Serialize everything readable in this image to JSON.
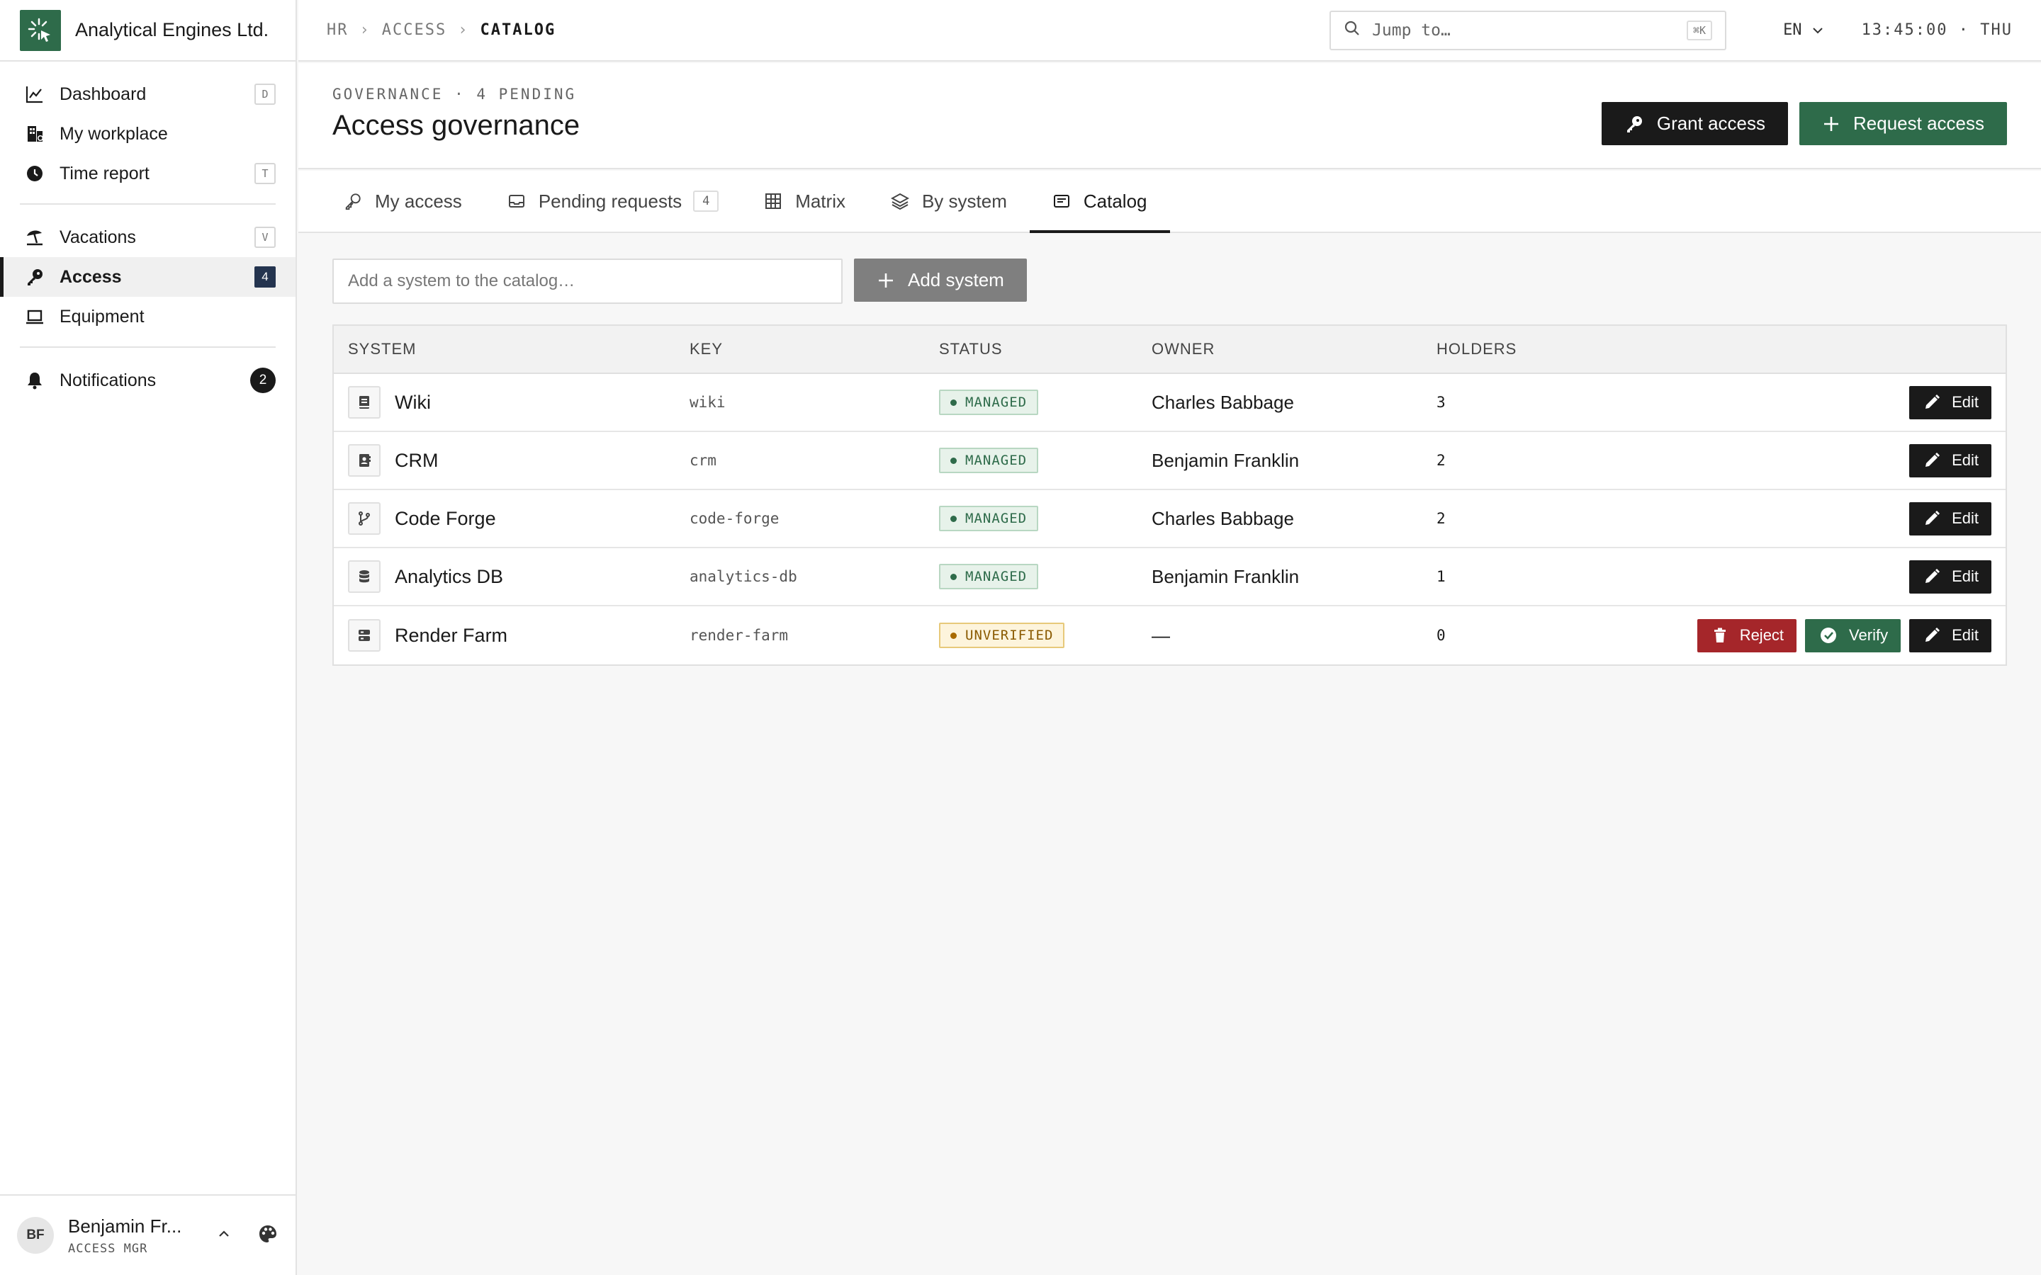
{
  "brand": {
    "name": "Analytical Engines Ltd.",
    "logo_icon": "spark-cursor-icon",
    "accent": "#2e6b4a"
  },
  "sidebar": {
    "groups": [
      [
        {
          "id": "dashboard",
          "label": "Dashboard",
          "icon": "chart-line-icon",
          "shortcut": "D"
        },
        {
          "id": "my-workplace",
          "label": "My workplace",
          "icon": "building-icon",
          "shortcut": ""
        },
        {
          "id": "time-report",
          "label": "Time report",
          "icon": "clock-icon",
          "shortcut": "T"
        }
      ],
      [
        {
          "id": "vacations",
          "label": "Vacations",
          "icon": "umbrella-beach-icon",
          "shortcut": "V"
        },
        {
          "id": "access",
          "label": "Access",
          "icon": "key-icon",
          "count": "4",
          "active": true
        },
        {
          "id": "equipment",
          "label": "Equipment",
          "icon": "laptop-icon",
          "shortcut": ""
        }
      ],
      [
        {
          "id": "notifications",
          "label": "Notifications",
          "icon": "bell-icon",
          "count": "2"
        }
      ]
    ]
  },
  "user": {
    "initials": "BF",
    "name": "Benjamin Fr...",
    "role": "ACCESS MGR"
  },
  "topbar": {
    "breadcrumb": [
      "HR",
      "ACCESS",
      "CATALOG"
    ],
    "search_placeholder": "Jump to…",
    "search_shortcut": "⌘K",
    "language": "EN",
    "clock": "13:45:00 · THU"
  },
  "header": {
    "eyebrow": "GOVERNANCE · 4 PENDING",
    "title": "Access governance",
    "grant_label": "Grant access",
    "request_label": "Request access"
  },
  "tabs": [
    {
      "label": "My access",
      "icon": "key-icon"
    },
    {
      "label": "Pending requests",
      "icon": "inbox-icon",
      "badge": "4"
    },
    {
      "label": "Matrix",
      "icon": "grid-icon"
    },
    {
      "label": "By system",
      "icon": "layers-icon"
    },
    {
      "label": "Catalog",
      "icon": "catalog-icon",
      "active": true
    }
  ],
  "catalog": {
    "add_placeholder": "Add a system to the catalog…",
    "add_button": "Add system",
    "columns": {
      "system": "SYSTEM",
      "key": "KEY",
      "status": "STATUS",
      "owner": "OWNER",
      "holders": "HOLDERS"
    },
    "rows": [
      {
        "name": "Wiki",
        "icon": "book-icon",
        "key": "wiki",
        "status": "MANAGED",
        "status_kind": "managed",
        "owner": "Charles Babbage",
        "holders": "3",
        "actions": [
          "edit"
        ]
      },
      {
        "name": "CRM",
        "icon": "contact-card-icon",
        "key": "crm",
        "status": "MANAGED",
        "status_kind": "managed",
        "owner": "Benjamin Franklin",
        "holders": "2",
        "actions": [
          "edit"
        ]
      },
      {
        "name": "Code Forge",
        "icon": "git-branch-icon",
        "key": "code-forge",
        "status": "MANAGED",
        "status_kind": "managed",
        "owner": "Charles Babbage",
        "holders": "2",
        "actions": [
          "edit"
        ]
      },
      {
        "name": "Analytics DB",
        "icon": "database-icon",
        "key": "analytics-db",
        "status": "MANAGED",
        "status_kind": "managed",
        "owner": "Benjamin Franklin",
        "holders": "1",
        "actions": [
          "edit"
        ]
      },
      {
        "name": "Render Farm",
        "icon": "server-icon",
        "key": "render-farm",
        "status": "UNVERIFIED",
        "status_kind": "unverified",
        "owner": "—",
        "holders": "0",
        "actions": [
          "reject",
          "verify",
          "edit"
        ]
      }
    ],
    "action_labels": {
      "edit": "Edit",
      "reject": "Reject",
      "verify": "Verify"
    }
  }
}
